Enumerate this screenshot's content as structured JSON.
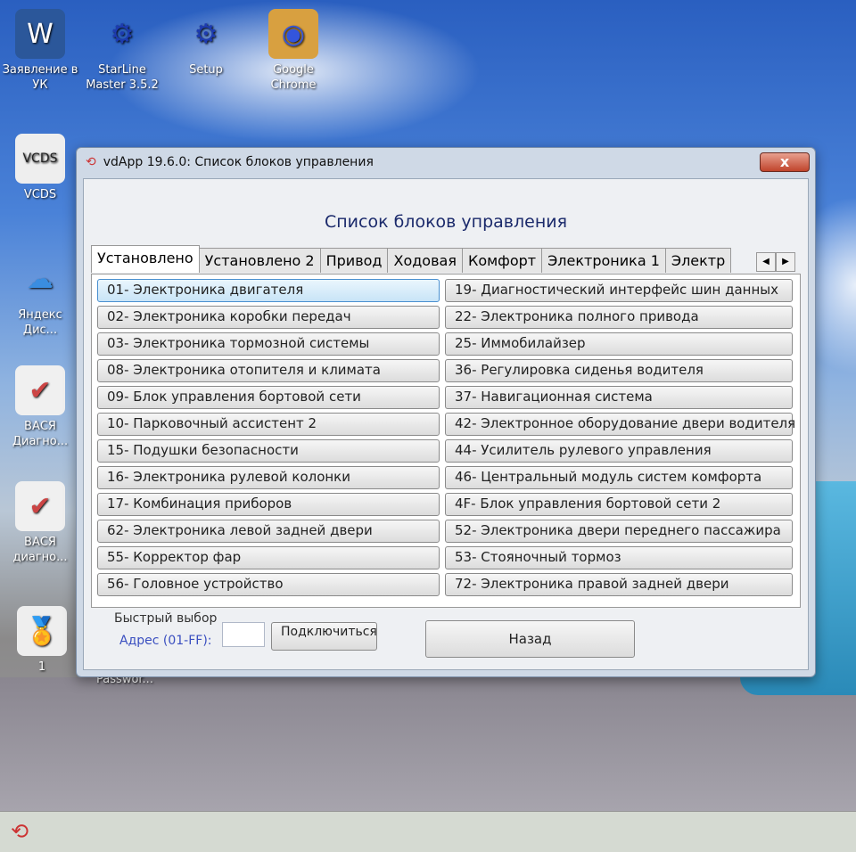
{
  "desktop": {
    "icons": [
      {
        "label": "Заявление в УК",
        "icon": "word-document-icon"
      },
      {
        "label": "StarLine Master 3.5.2",
        "icon": "gear-wrench-icon"
      },
      {
        "label": "Setup",
        "icon": "gear-wrench-icon"
      },
      {
        "label": "Google Chrome",
        "icon": "chrome-icon"
      },
      {
        "label": "VCDS",
        "icon": "vcds-icon"
      },
      {
        "label": "Яндекс Дис...",
        "icon": "yandex-disk-icon"
      },
      {
        "label": "ВАСЯ Диагно...",
        "icon": "vasya-icon"
      },
      {
        "label": "ВАСЯ диагно...",
        "icon": "vasya-icon"
      },
      {
        "label": "1",
        "icon": "certificate-icon"
      },
      {
        "label": "Passwor...",
        "icon": "file-icon"
      }
    ]
  },
  "window": {
    "title": "vdApp 19.6.0:  Список блоков управления",
    "close": "x",
    "heading": "Список блоков управления",
    "tabs": [
      "Установлено",
      "Установлено 2",
      "Привод",
      "Ходовая",
      "Комфорт",
      "Электроника 1",
      "Электр"
    ],
    "active_tab": "Установлено",
    "left": [
      "01- Электроника двигателя",
      "02- Электроника коробки передач",
      "03- Электроника тормозной системы",
      "08- Электроника отопителя и климата",
      "09- Блок управления бортовой сети",
      "10- Парковочный ассистент 2",
      "15- Подушки безопасности",
      "16- Электроника рулевой колонки",
      "17- Комбинация приборов",
      "62- Электроника левой задней двери",
      "55- Корректор фар",
      "56- Головное устройство"
    ],
    "right": [
      "19- Диагностический интерфейс шин данных",
      "22- Электроника полного привода",
      "25- Иммобилайзер",
      "36- Регулировка сиденья водителя",
      "37- Навигационная система",
      "42- Электронное оборудование двери водителя",
      "44- Усилитель рулевого управления",
      "46- Центральный модуль систем комфорта",
      "4F- Блок управления бортовой сети 2",
      "52- Электроника двери переднего пассажира",
      "53- Стояночный тормоз",
      "72- Электроника правой задней двери"
    ],
    "quick_select": "Быстрый выбор",
    "address_label": "Адрес (01-FF):",
    "address_value": "",
    "connect": "Подключиться",
    "back": "Назад"
  }
}
